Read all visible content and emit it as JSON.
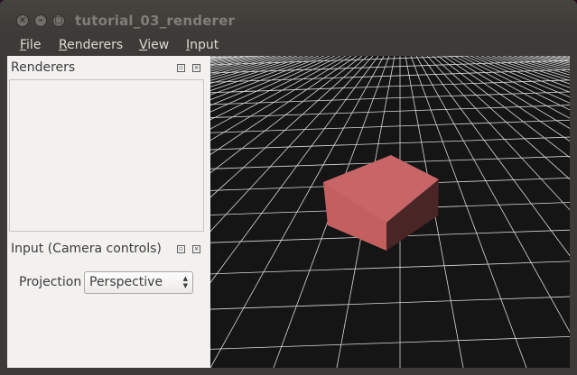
{
  "window": {
    "title": "tutorial_03_renderer",
    "close_glyph": "×",
    "minimize_glyph": "–",
    "maximize_glyph": "□"
  },
  "menu": {
    "items": [
      {
        "mnemonic": "F",
        "rest": "ile"
      },
      {
        "mnemonic": "R",
        "rest": "enderers"
      },
      {
        "mnemonic": "V",
        "rest": "iew"
      },
      {
        "mnemonic": "I",
        "rest": "nput"
      }
    ]
  },
  "docks": {
    "renderers": {
      "title": "Renderers",
      "float_glyph": "▫",
      "close_glyph": "×"
    },
    "input": {
      "title": "Input (Camera controls)",
      "float_glyph": "▫",
      "close_glyph": "×",
      "projection_label": "Projection",
      "projection_value": "Perspective",
      "arrows": "▲▼"
    }
  },
  "viewport": {
    "background": "#151515",
    "grid_color": "#d9d9d9",
    "box_front_color": "#c86566",
    "box_top_color": "#c86566",
    "box_side_color": "#4a2526"
  }
}
